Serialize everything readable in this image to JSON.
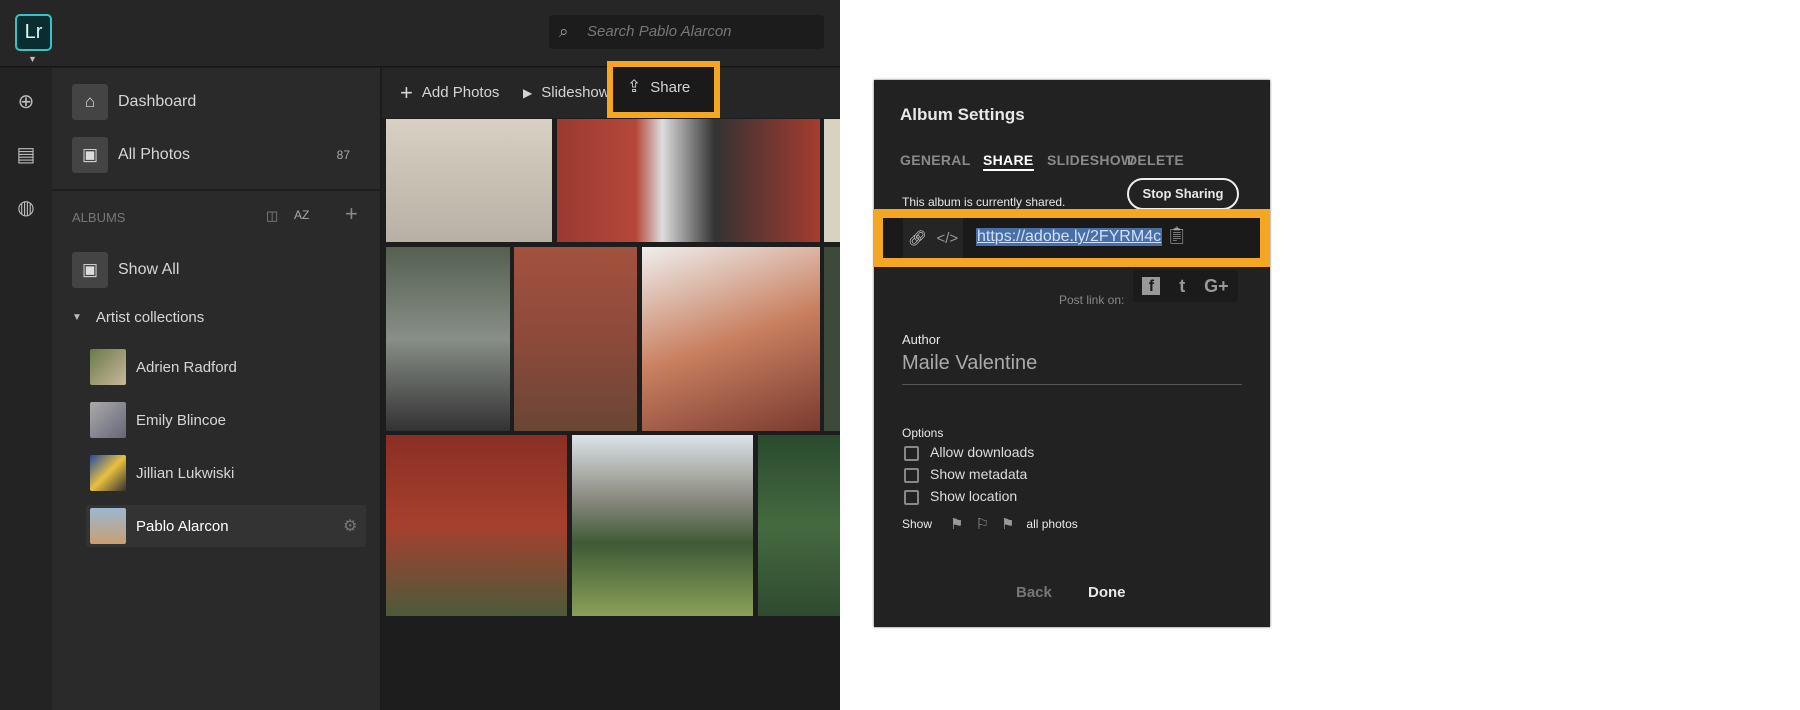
{
  "app": {
    "logo": "Lr",
    "search_placeholder": "Search Pablo Alarcon"
  },
  "rail": {
    "icons": [
      "add-icon",
      "library-icon",
      "globe-icon"
    ]
  },
  "sidebar": {
    "dashboard": "Dashboard",
    "all_photos": "All Photos",
    "all_photos_count": "87",
    "albums_header": "ALBUMS",
    "sort_label": "AZ",
    "show_all": "Show All",
    "collection": "Artist collections",
    "albums": [
      "Adrien Radford",
      "Emily Blincoe",
      "Jillian Lukwiski",
      "Pablo Alarcon"
    ],
    "selected": "Pablo Alarcon"
  },
  "toolbar": {
    "add_photos": "Add Photos",
    "slideshow": "Slideshow",
    "share": "Share"
  },
  "dialog": {
    "title": "Album Settings",
    "tabs": [
      "GENERAL",
      "SHARE",
      "SLIDESHOW",
      "DELETE"
    ],
    "active_tab": "SHARE",
    "status": "This album is currently shared.",
    "stop_sharing": "Stop Sharing",
    "link": "https://adobe.ly/2FYRM4c",
    "post_link_on": "Post link on:",
    "social": [
      "f",
      "t",
      "G+"
    ],
    "author_label": "Author",
    "author_value": "Maile Valentine",
    "options_label": "Options",
    "options": [
      {
        "label": "Allow downloads",
        "checked": false
      },
      {
        "label": "Show metadata",
        "checked": false
      },
      {
        "label": "Show location",
        "checked": false
      }
    ],
    "show_label": "Show",
    "show_value": "all photos",
    "back": "Back",
    "done": "Done"
  },
  "colors": {
    "highlight": "#f5a623",
    "logo": "#31c5c5",
    "link_selection": "#4a6fa5"
  }
}
